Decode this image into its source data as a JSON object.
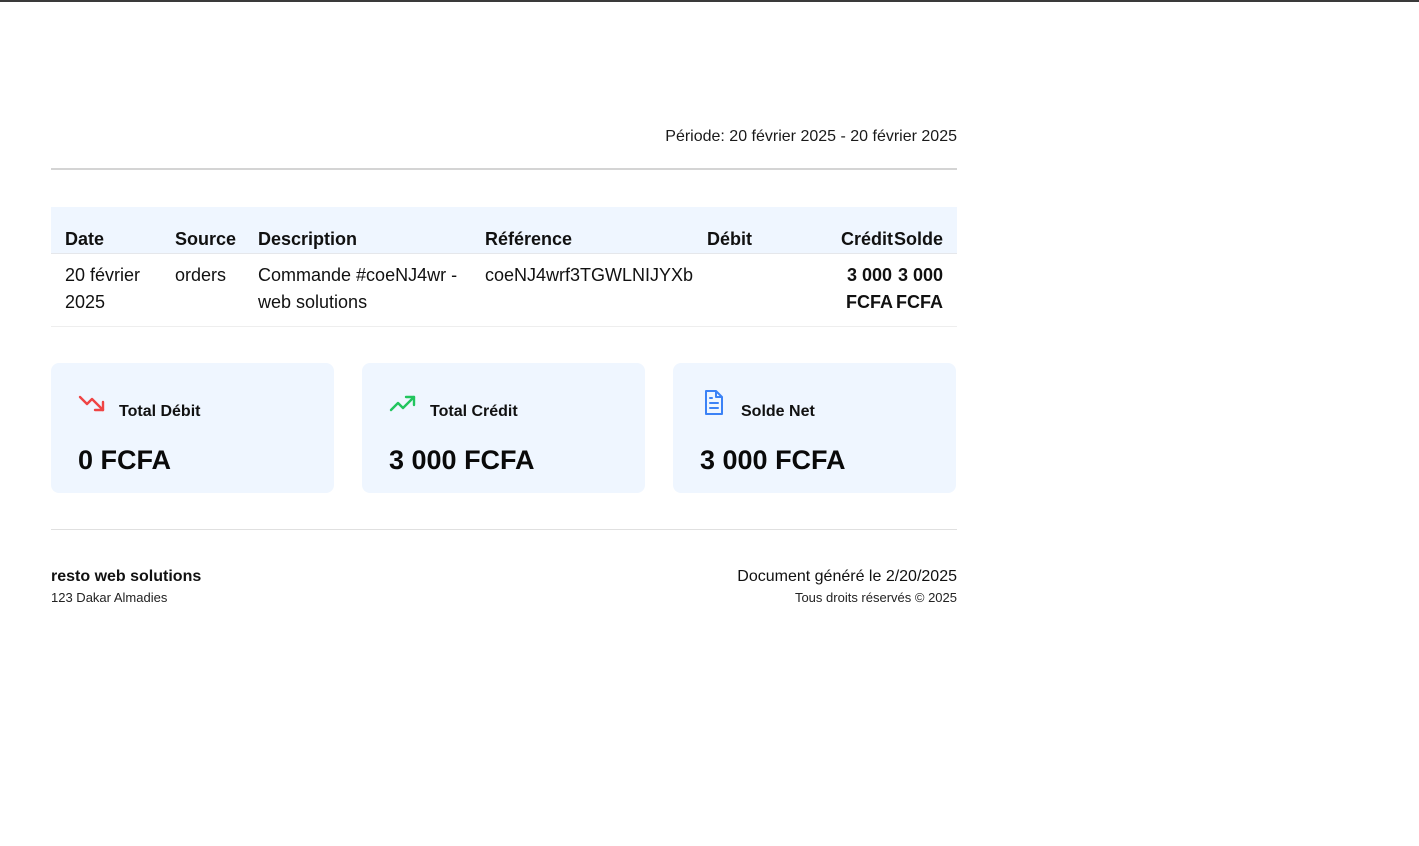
{
  "header": {
    "period": "Période: 20 février 2025 - 20 février 2025"
  },
  "table": {
    "columns": [
      "Date",
      "Source",
      "Description",
      "Référence",
      "Débit",
      "Crédit",
      "Solde"
    ],
    "rows": [
      {
        "date_line1": "20 février",
        "date_line2": "2025",
        "source": "orders",
        "description_line1": "Commande #coeNJ4wr -",
        "description_line2": "web solutions",
        "reference": "coeNJ4wrf3TGWLNIJYXb",
        "debit": "",
        "credit_line1": "3 000",
        "credit_line2": "FCFA",
        "balance_line1": "3 000",
        "balance_line2": "FCFA"
      }
    ]
  },
  "summary": {
    "total_debit": {
      "label": "Total Débit",
      "value": "0 FCFA",
      "icon": "trending-down-icon",
      "color": "#ef4444"
    },
    "total_credit": {
      "label": "Total Crédit",
      "value": "3 000 FCFA",
      "icon": "trending-up-icon",
      "color": "#22c55e"
    },
    "net_balance": {
      "label": "Solde Net",
      "value": "3 000 FCFA",
      "icon": "document-icon",
      "color": "#3b82f6"
    }
  },
  "footer": {
    "company_name": "resto web solutions",
    "company_address": "123 Dakar Almadies",
    "generated": "Document généré le 2/20/2025",
    "rights": "Tous droits réservés © 2025"
  }
}
